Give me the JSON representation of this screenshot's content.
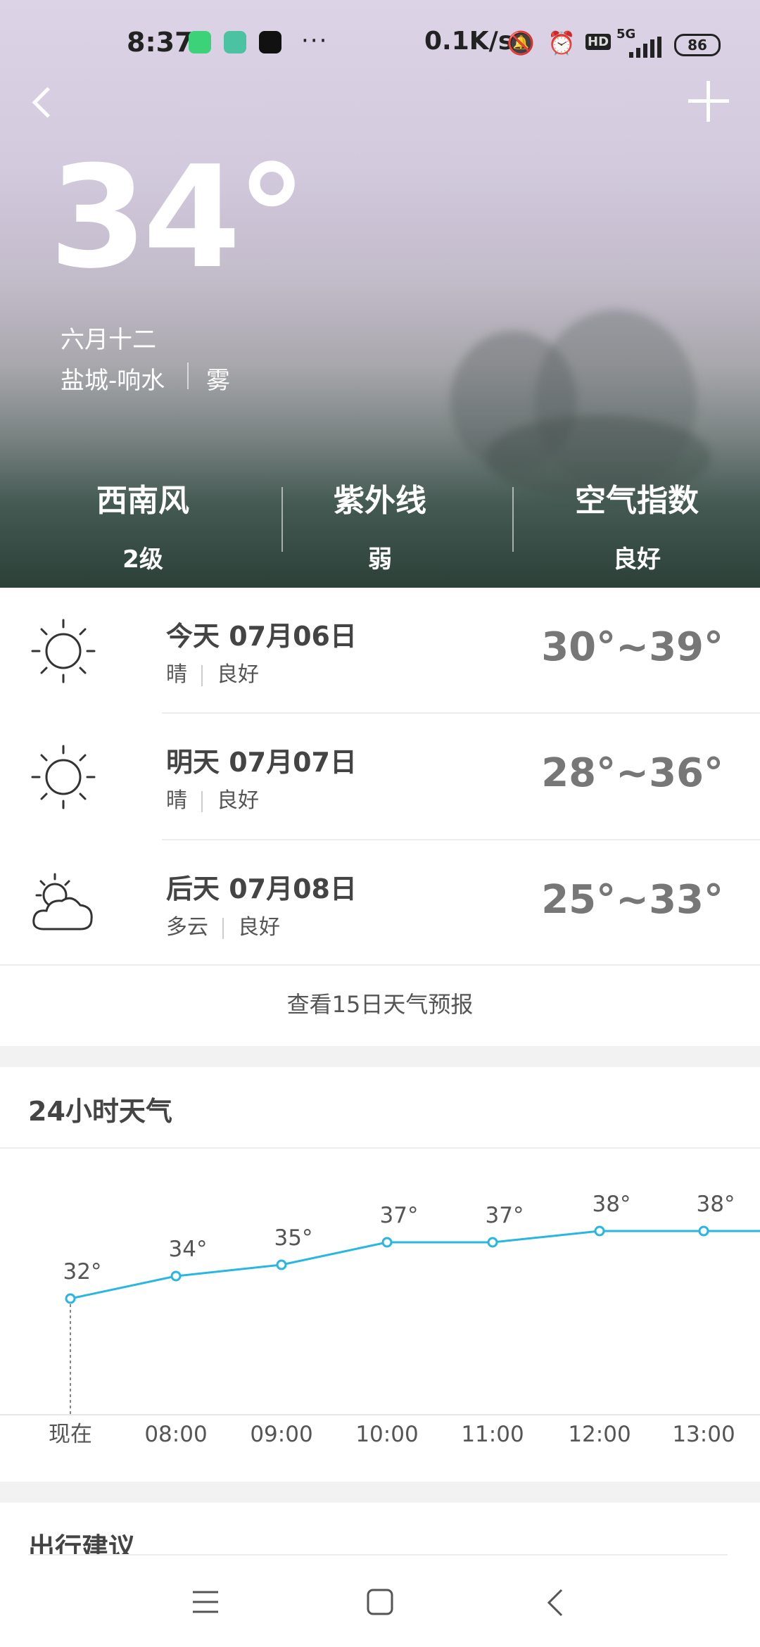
{
  "status_bar": {
    "time": "8:37",
    "network_speed": "0.1K/s",
    "signal": "5G",
    "hd": "HD",
    "battery": "86"
  },
  "current": {
    "temperature": "34°",
    "lunar_date": "六月十二",
    "location": "盐城-响水",
    "condition": "雾"
  },
  "stats": [
    {
      "label": "西南风",
      "value": "2级"
    },
    {
      "label": "紫外线",
      "value": "弱"
    },
    {
      "label": "空气指数",
      "value": "良好"
    }
  ],
  "forecast": [
    {
      "day": "今天 07月06日",
      "weather": "晴",
      "air": "良好",
      "range": "30°~39°",
      "icon": "sun-icon"
    },
    {
      "day": "明天 07月07日",
      "weather": "晴",
      "air": "良好",
      "range": "28°~36°",
      "icon": "sun-icon"
    },
    {
      "day": "后天 07月08日",
      "weather": "多云",
      "air": "良好",
      "range": "25°~33°",
      "icon": "partly-cloudy-icon"
    }
  ],
  "forecast_link": "查看15日天气预报",
  "hourly_title": "24小时天气",
  "travel_title": "出行建议",
  "chart_data": {
    "type": "line",
    "categories": [
      "现在",
      "08:00",
      "09:00",
      "10:00",
      "11:00",
      "12:00",
      "13:00"
    ],
    "values": [
      32,
      34,
      35,
      37,
      37,
      38,
      38
    ],
    "value_labels": [
      "32°",
      "34°",
      "35°",
      "37°",
      "37°",
      "38°",
      "38°"
    ],
    "color": "#29b6e0"
  }
}
